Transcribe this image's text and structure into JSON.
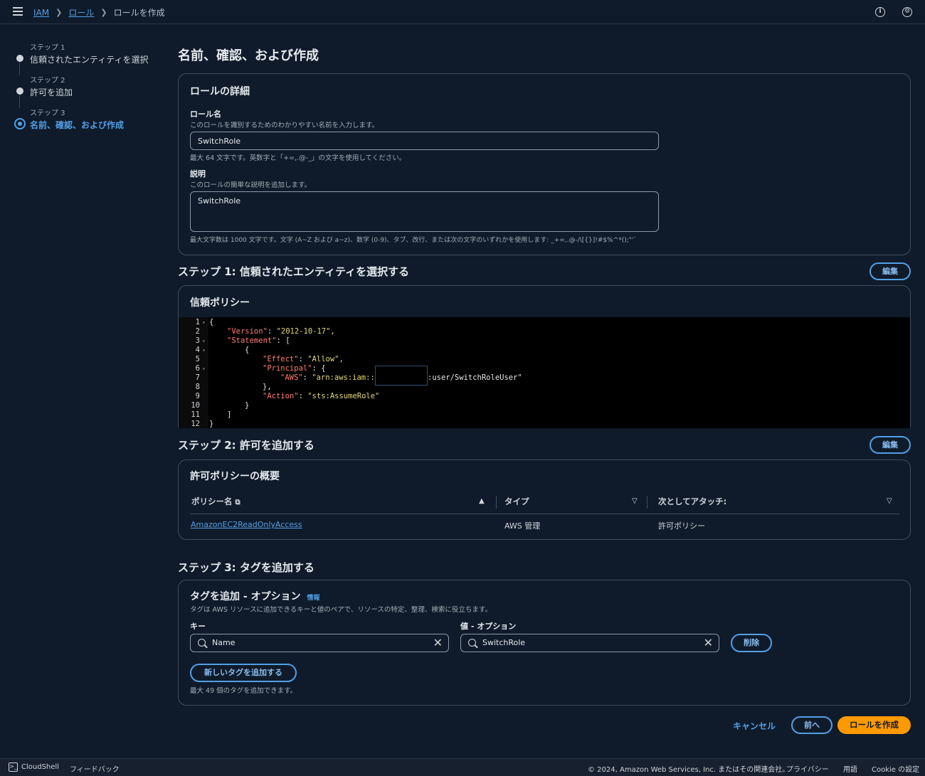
{
  "breadcrumb": {
    "root": "IAM",
    "roles": "ロール",
    "current": "ロールを作成"
  },
  "steps": [
    {
      "small": "ステップ 1",
      "label": "信頼されたエンティティを選択"
    },
    {
      "small": "ステップ 2",
      "label": "許可を追加"
    },
    {
      "small": "ステップ 3",
      "label": "名前、確認、および作成"
    }
  ],
  "page_title": "名前、確認、および作成",
  "role_details": {
    "heading": "ロールの詳細",
    "name_label": "ロール名",
    "name_desc": "このロールを識別するためのわかりやすい名前を入力します。",
    "name_value": "SwitchRole",
    "name_hint": "最大 64 文字です。英数字と「+=,.@-_」の文字を使用してください。",
    "desc_label": "説明",
    "desc_desc": "このロールの簡単な説明を追加します。",
    "desc_value": "SwitchRole",
    "desc_hint": "最大文字数は 1000 文字です。文字 (A~Z および a~z)、数字 (0-9)、タブ、改行、または次の文字のいずれかを使用します: _+=,.@-/\\[{}]!#$%^*();\"'`"
  },
  "step1": {
    "heading": "ステップ 1: 信頼されたエンティティを選択する",
    "edit": "編集",
    "policy_heading": "信頼ポリシー",
    "line_numbers": [
      "1",
      "2",
      "3",
      "4",
      "5",
      "6",
      "7",
      "8",
      "9",
      "10",
      "11",
      "12"
    ],
    "code": {
      "l1": "{",
      "l2k": "\"Version\"",
      "l2v": "\"2012-10-17\",",
      "l3k": "\"Statement\"",
      "l3v": "[",
      "l4": "{",
      "l5k": "\"Effect\"",
      "l5v": "\"Allow\",",
      "l6k": "\"Principal\"",
      "l6v": "{",
      "l7k": "\"AWS\"",
      "l7v": "\"arn:aws:iam::",
      "l7v2": ":user/SwitchRoleUser\"",
      "l8": "},",
      "l9k": "\"Action\"",
      "l9v": "\"sts:AssumeRole\"",
      "l10": "}",
      "l11": "]",
      "l12": "}"
    }
  },
  "step2": {
    "heading": "ステップ 2: 許可を追加する",
    "edit": "編集",
    "summary_heading": "許可ポリシーの概要",
    "columns": [
      "ポリシー名",
      "タイプ",
      "次としてアタッチ:"
    ],
    "rows": [
      {
        "name": "AmazonEC2ReadOnlyAccess",
        "type": "AWS 管理",
        "attach": "許可ポリシー"
      }
    ]
  },
  "step3": {
    "heading": "ステップ 3: タグを追加する",
    "tags_heading": "タグを追加 - オプション",
    "info": "情報",
    "tags_desc": "タグは AWS リソースに追加できるキーと値のペアで、リソースの特定、整理、検索に役立ちます。",
    "key_label": "キー",
    "value_label": "値 - オプション",
    "key_value": "Name",
    "value_value": "SwitchRole",
    "remove": "削除",
    "add_tag": "新しいタグを追加する",
    "add_hint": "最大 49 個のタグを追加できます。"
  },
  "actions": {
    "cancel": "キャンセル",
    "prev": "前へ",
    "create": "ロールを作成"
  },
  "footer": {
    "cloudshell": "CloudShell",
    "feedback": "フィードバック",
    "copyright": "© 2024, Amazon Web Services, Inc. またはその関連会社。",
    "privacy": "プライバシー",
    "terms": "用語",
    "cookie": "Cookie の設定"
  },
  "colors": {
    "accent": "#539fe5",
    "primary_button": "#ff9900",
    "background": "#0f1b2a"
  }
}
